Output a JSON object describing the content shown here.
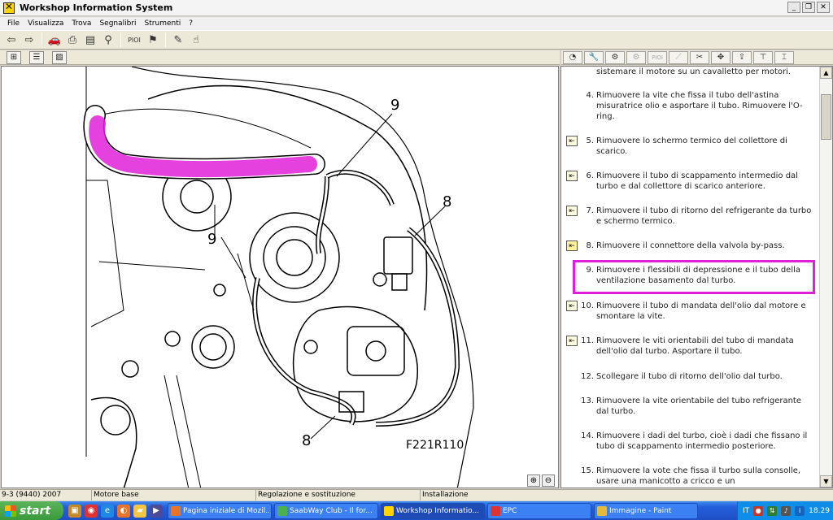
{
  "window": {
    "title": "Workshop Information System",
    "min": "_",
    "restore": "❐",
    "close": "✕"
  },
  "menu": [
    "File",
    "Visualizza",
    "Trova",
    "Segnalibri",
    "Strumenti",
    "?"
  ],
  "toolbar": {
    "pioi_label": "PIOI"
  },
  "right_toolbar": {
    "pioi_label": "PIOI"
  },
  "diagram": {
    "figure_code": "F221R110",
    "callouts": [
      "9",
      "9",
      "8",
      "8"
    ],
    "highlight_color": "#e020d8"
  },
  "instructions": {
    "steps": [
      {
        "num": "",
        "text": "sistemare il motore su un cavalletto per motori.",
        "icon": ""
      },
      {
        "num": "4.",
        "text": "Rimuovere la vite che fissa il tubo dell'astina misuratrice olio e asportare il tubo. Rimuovere l'O-ring.",
        "icon": ""
      },
      {
        "num": "5.",
        "text": "Rimuovere lo schermo termico del collettore di scarico.",
        "icon": "arrow-in-icon"
      },
      {
        "num": "6.",
        "text": "Rimuovere il tubo di scappamento intermedio dal turbo e dal collettore di scarico anteriore.",
        "icon": "arrow-in-icon"
      },
      {
        "num": "7.",
        "text": "Rimuovere il tubo di ritorno del refrigerante da turbo e schermo termico.",
        "icon": "arrow-in-icon"
      },
      {
        "num": "8.",
        "text": "Rimuovere il connettore della valvola by-pass.",
        "icon": "connector-icon"
      },
      {
        "num": "9.",
        "text": "Rimuovere i flessibili di depressione e il tubo della ventilazione basamento dal turbo.",
        "icon": ""
      },
      {
        "num": "10.",
        "text": "Rimuovere il tubo di mandata dell'olio dal motore e smontare la vite.",
        "icon": "arrow-in-icon"
      },
      {
        "num": "11.",
        "text": "Rimuovere le viti orientabili del tubo di mandata dell'olio dal turbo. Asportare il tubo.",
        "icon": "arrow-in-icon"
      },
      {
        "num": "12.",
        "text": "Scollegare il tubo di ritorno dell'olio dal turbo.",
        "icon": ""
      },
      {
        "num": "13.",
        "text": "Rimuovere la vite orientabile del tubo refrigerante dal turbo.",
        "icon": ""
      },
      {
        "num": "14.",
        "text": "Rimuovere i dadi del turbo, cioè i dadi che fissano il tubo di scappamento intermedio posteriore.",
        "icon": ""
      },
      {
        "num": "15.",
        "text": "Rimuovere la vote che fissa il turbo sulla consolle, usare una manicotto a cricco e un",
        "icon": ""
      }
    ],
    "highlight_step": "9."
  },
  "status": [
    "9-3 (9440) 2007",
    "Motore base",
    "Regolazione e sostituzione",
    "Installazione"
  ],
  "taskbar": {
    "start": "start",
    "tasks": [
      {
        "label": "Pagina iniziale di Mozil...",
        "color": "#e8732a"
      },
      {
        "label": "SaabWay Club - Il for...",
        "color": "#4caf50"
      },
      {
        "label": "Workshop Informatio...",
        "color": "#ffd400"
      },
      {
        "label": "EPC",
        "color": "#d33"
      },
      {
        "label": "Immagine - Paint",
        "color": "#e6b93a"
      }
    ],
    "lang": "IT",
    "clock": "18.29"
  }
}
